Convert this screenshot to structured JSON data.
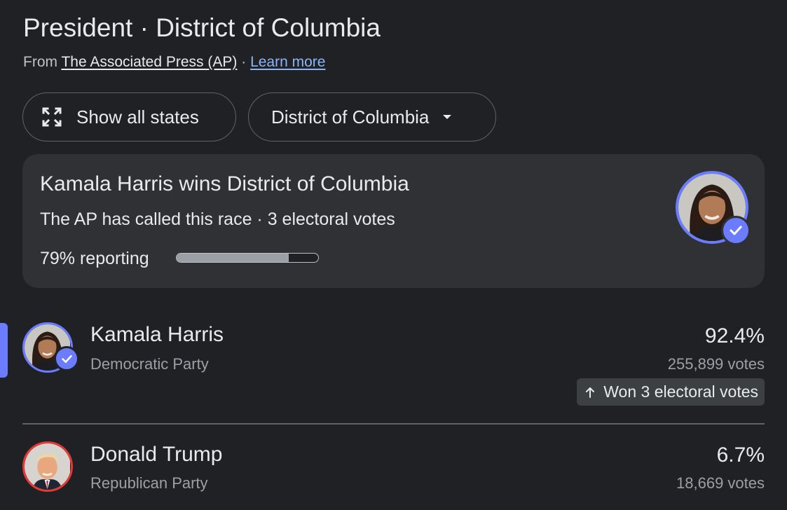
{
  "header": {
    "title": "President · District of Columbia",
    "source_prefix": "From ",
    "source_name": "The Associated Press (AP)",
    "source_separator": " · ",
    "learn_more": "Learn more"
  },
  "chips": {
    "show_all_states": "Show all states",
    "show_all_states_icon": "expand-icon",
    "region": "District of Columbia",
    "region_icon": "caret-down-icon"
  },
  "result_card": {
    "headline": "Kamala Harris wins District of Columbia",
    "subline": "The AP has called this race · 3 electoral votes",
    "reporting_label": "79% reporting",
    "reporting_fraction": 0.79,
    "winner_avatar": "kamala-harris-photo",
    "winner_badge_icon": "check-icon"
  },
  "candidates": [
    {
      "name": "Kamala Harris",
      "party": "Democratic Party",
      "percent": "92.4%",
      "votes": "255,899 votes",
      "won_label": "Won 3 electoral votes",
      "won_icon": "arrow-up-icon",
      "avatar": "kamala-harris-photo",
      "ring_color": "#6b7cff",
      "winner": true
    },
    {
      "name": "Donald Trump",
      "party": "Republican Party",
      "percent": "6.7%",
      "votes": "18,669 votes",
      "avatar": "donald-trump-photo",
      "ring_color": "#e53935",
      "winner": false
    }
  ],
  "colors": {
    "background": "#202124",
    "card": "#303134",
    "accent": "#6b7cff",
    "republican": "#e53935",
    "link": "#8ab4f8"
  }
}
